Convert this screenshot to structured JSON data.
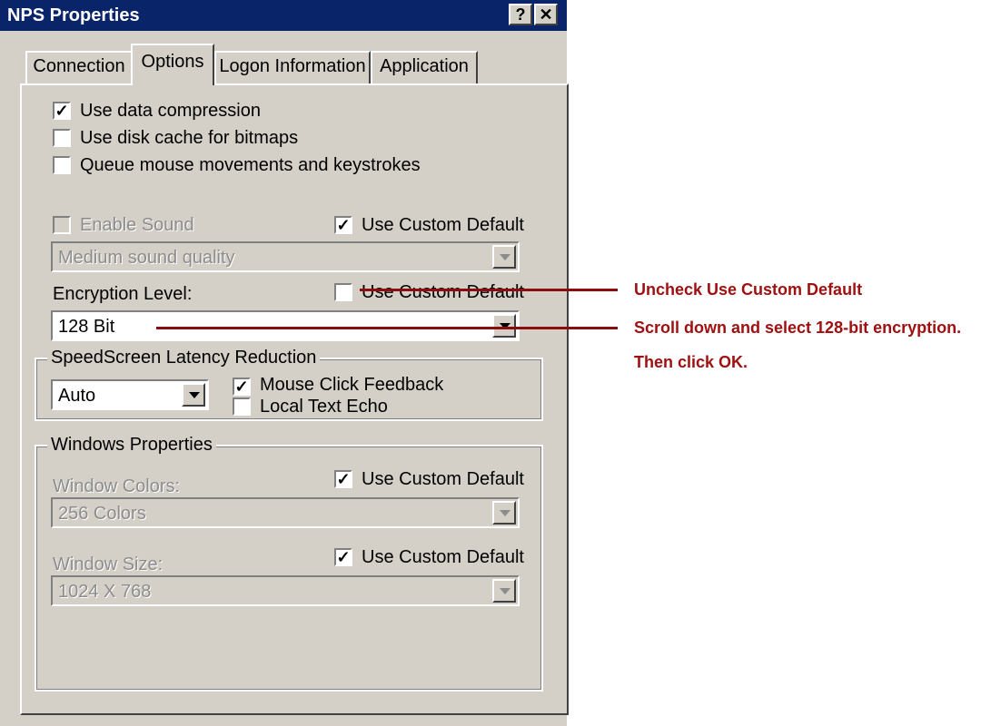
{
  "window": {
    "title": "NPS Properties",
    "help_button": "?",
    "close_button": "✕"
  },
  "tabs": [
    {
      "label": "Connection"
    },
    {
      "label": "Options"
    },
    {
      "label": "Logon Information"
    },
    {
      "label": "Application"
    }
  ],
  "options": {
    "data_compression": {
      "label": "Use data compression",
      "checked": true
    },
    "disk_cache": {
      "label": "Use disk cache for bitmaps",
      "checked": false
    },
    "queue_mouse": {
      "label": "Queue mouse movements and keystrokes",
      "checked": false
    }
  },
  "sound": {
    "enable_label": "Enable Sound",
    "custom_default_label": "Use Custom Default",
    "quality_value": "Medium sound quality"
  },
  "encryption": {
    "label": "Encryption Level:",
    "custom_default_label": "Use Custom Default",
    "value": "128 Bit"
  },
  "speedscreen": {
    "group_label": "SpeedScreen Latency Reduction",
    "mode_value": "Auto",
    "mouse_click_label": "Mouse Click Feedback",
    "local_text_label": "Local Text Echo"
  },
  "windows_props": {
    "group_label": "Windows Properties",
    "colors_label": "Window Colors:",
    "colors_custom_label": "Use Custom Default",
    "colors_value": "256 Colors",
    "size_label": "Window Size:",
    "size_custom_label": "Use Custom Default",
    "size_value": "1024 X 768"
  },
  "annotations": {
    "note1": "Uncheck Use Custom Default",
    "note2": "Scroll down and select 128-bit encryption.",
    "note3": "Then click OK."
  },
  "check_glyph": "✓",
  "colors": {
    "title_bar": "#0a246a",
    "annotation": "#a01010",
    "window_face": "#d4d0c8"
  }
}
